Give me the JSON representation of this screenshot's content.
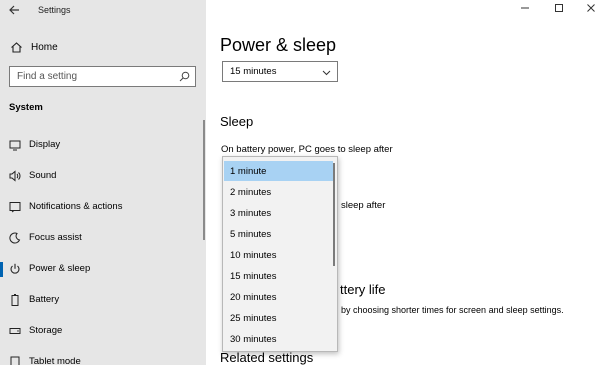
{
  "window": {
    "app_title": "Settings",
    "back_icon": "back-arrow-icon"
  },
  "sidebar": {
    "home_label": "Home",
    "search": {
      "placeholder": "Find a setting"
    },
    "section_label": "System",
    "items": [
      {
        "label": "Display",
        "icon": "display-icon"
      },
      {
        "label": "Sound",
        "icon": "sound-icon"
      },
      {
        "label": "Notifications & actions",
        "icon": "notifications-icon"
      },
      {
        "label": "Focus assist",
        "icon": "focus-assist-icon"
      },
      {
        "label": "Power & sleep",
        "icon": "power-icon",
        "active": true
      },
      {
        "label": "Battery",
        "icon": "battery-icon"
      },
      {
        "label": "Storage",
        "icon": "storage-icon"
      },
      {
        "label": "Tablet mode",
        "icon": "tablet-icon"
      }
    ]
  },
  "main": {
    "page_title": "Power & sleep",
    "screen_select_value": "15 minutes",
    "sleep_heading": "Sleep",
    "battery_sleep_label": "On battery power, PC goes to sleep after",
    "plugged_label_fragment": "sleep after",
    "battery_heading_fragment": "ttery life",
    "battery_desc_fragment": "by choosing shorter times for screen and sleep settings.",
    "related_heading_fragment": "Related settings"
  },
  "dropdown": {
    "selected_index": 0,
    "options": [
      "1 minute",
      "2 minutes",
      "3 minutes",
      "5 minutes",
      "10 minutes",
      "15 minutes",
      "20 minutes",
      "25 minutes",
      "30 minutes"
    ]
  },
  "colors": {
    "accent": "#0063b1",
    "selection": "#a8d2f3",
    "sidebar_bg": "#e6e6e6"
  }
}
